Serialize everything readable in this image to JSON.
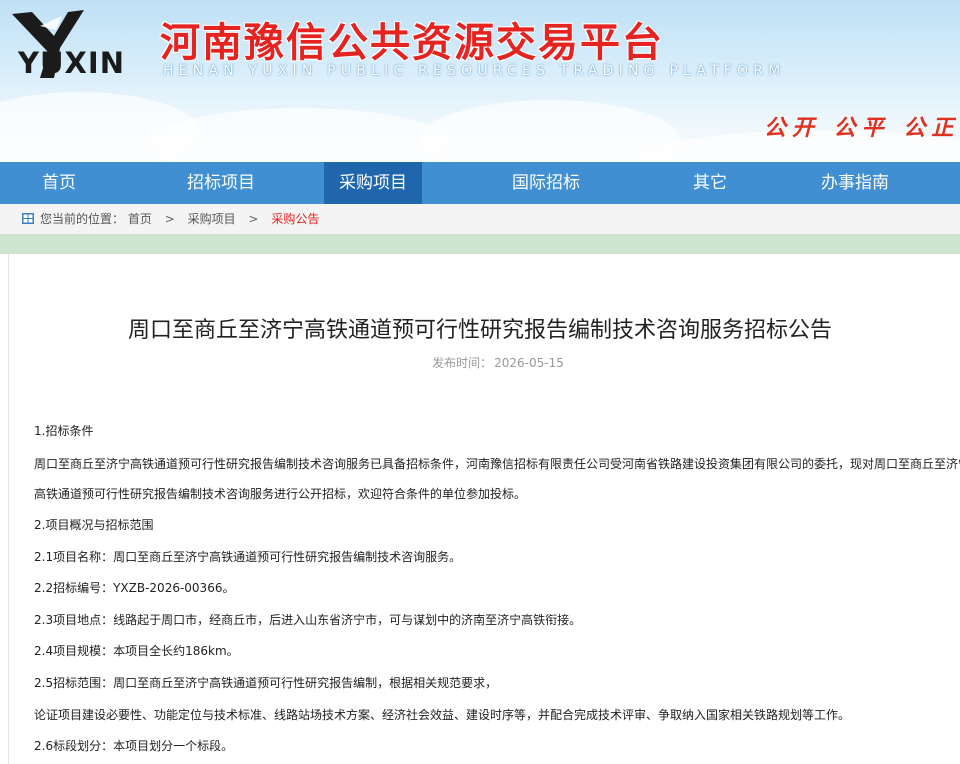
{
  "header": {
    "logo_text": "YUXIN",
    "title": "河南豫信公共资源交易平台",
    "subtitle": "HENAN YUXIN PUBLIC RESOURCES TRADING PLATFORM",
    "slogan": "公开 公平 公正 诚",
    "colors": {
      "title": "#e52320",
      "nav": "#3f8fd2",
      "nav_active": "#1f66ad"
    },
    "logo_icon": "eagle-logo-icon"
  },
  "nav": {
    "items": [
      {
        "label": "首页"
      },
      {
        "label": "招标项目"
      },
      {
        "label": "采购项目",
        "active": true
      },
      {
        "label": "国际招标"
      },
      {
        "label": "其它"
      },
      {
        "label": "办事指南"
      }
    ]
  },
  "breadcrumb": {
    "icon": "location-grid-icon",
    "prefix": "您当前的位置：",
    "items": [
      "首页",
      "采购项目",
      "采购公告"
    ],
    "separator": ">"
  },
  "article": {
    "title": "周口至商丘至济宁高铁通道预可行性研究报告编制技术咨询服务招标公告",
    "date_label": "发布时间：",
    "date": "2026-05-15",
    "paragraphs": [
      "1.招标条件",
      "周口至商丘至济宁高铁通道预可行性研究报告编制技术咨询服务已具备招标条件，河南豫信招标有限责任公司受河南省铁路建设投资集团有限公司的委托，现对周口至商丘至济宁",
      "高铁通道预可行性研究报告编制技术咨询服务进行公开招标，欢迎符合条件的单位参加投标。",
      "2.项目概况与招标范围",
      "2.1项目名称：周口至商丘至济宁高铁通道预可行性研究报告编制技术咨询服务。",
      "2.2招标编号：YXZB-2026-00366。",
      "2.3项目地点：线路起于周口市，经商丘市，后进入山东省济宁市，可与谋划中的济南至济宁高铁衔接。",
      "2.4项目规模：本项目全长约186km。",
      "2.5招标范围：周口至商丘至济宁高铁通道预可行性研究报告编制，根据相关规范要求，",
      "论证项目建设必要性、功能定位与技术标准、线路站场技术方案、经济社会效益、建设时序等，并配合完成技术评审、争取纳入国家相关铁路规划等工作。",
      "2.6标段划分：本项目划分一个标段。"
    ]
  }
}
